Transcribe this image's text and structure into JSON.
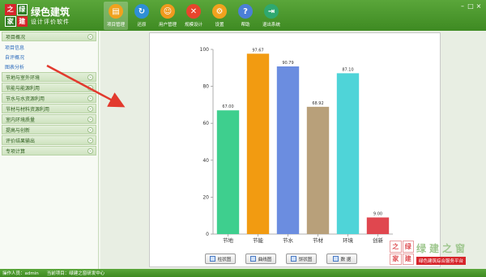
{
  "app": {
    "logo_chars": [
      "之",
      "绿",
      "家",
      "建"
    ],
    "title": "绿色建筑",
    "subtitle": "设计评价软件"
  },
  "toolbar": [
    {
      "label": "项目管理",
      "icon": "folder-icon",
      "color": "#f0a21e",
      "glyph": "▤",
      "active": true
    },
    {
      "label": "还原",
      "icon": "refresh-icon",
      "color": "#2f8fd6",
      "glyph": "↻",
      "active": false
    },
    {
      "label": "用户管理",
      "icon": "users-icon",
      "color": "#f09a1e",
      "glyph": "☺",
      "active": false
    },
    {
      "label": "规模设计",
      "icon": "tools-icon",
      "color": "#e8452c",
      "glyph": "✕",
      "active": false
    },
    {
      "label": "设置",
      "icon": "gear-icon",
      "color": "#f0a21e",
      "glyph": "⚙",
      "active": false
    },
    {
      "label": "帮助",
      "icon": "help-icon",
      "color": "#4b7fd6",
      "glyph": "?",
      "active": false
    },
    {
      "label": "退出系统",
      "icon": "exit-icon",
      "color": "#2fa870",
      "glyph": "⇥",
      "active": false
    }
  ],
  "window_controls": [
    "–",
    "□",
    "×"
  ],
  "sidebar": {
    "sections": [
      {
        "label": "项目概况",
        "children": [
          "项目信息",
          "自评概况",
          "图表分析"
        ]
      },
      {
        "label": "节地与室外环境",
        "children": []
      },
      {
        "label": "节能与能源利用",
        "children": []
      },
      {
        "label": "节水与水资源利用",
        "children": []
      },
      {
        "label": "节材与材料资源利用",
        "children": []
      },
      {
        "label": "室内环境质量",
        "children": []
      },
      {
        "label": "提高与创新",
        "children": []
      },
      {
        "label": "评价结果输出",
        "children": []
      },
      {
        "label": "专项计算",
        "children": []
      }
    ],
    "expand_glyph": "»"
  },
  "chart_data": {
    "type": "bar",
    "categories": [
      "节地",
      "节能",
      "节水",
      "节材",
      "环境",
      "创新"
    ],
    "values": [
      67.0,
      97.67,
      90.79,
      68.92,
      87.1,
      9.0
    ],
    "value_labels": [
      "67.00",
      "97.67",
      "90.79",
      "68.92",
      "87.10",
      "9.00"
    ],
    "colors": [
      "#3ecf8e",
      "#f29b11",
      "#6b8de0",
      "#b8a07a",
      "#4fd4d8",
      "#e0474f"
    ],
    "ylim": [
      0,
      100
    ],
    "yticks": [
      "0",
      "20",
      "40",
      "60",
      "80",
      "100"
    ]
  },
  "chart_buttons": [
    {
      "label": "柱状图",
      "icon": "bar-chart-icon"
    },
    {
      "label": "曲线图",
      "icon": "line-chart-icon"
    },
    {
      "label": "饼状图",
      "icon": "pie-chart-icon"
    },
    {
      "label": "数 据",
      "icon": "data-table-icon"
    }
  ],
  "watermark": {
    "logo_chars": [
      "之",
      "绿",
      "家",
      "建"
    ],
    "text": "绿建之窗",
    "sub": "绿色建筑综合服务平台"
  },
  "status": {
    "operator": "操作人员：admin",
    "project": "当前项目：绿建之窗研发中心"
  }
}
